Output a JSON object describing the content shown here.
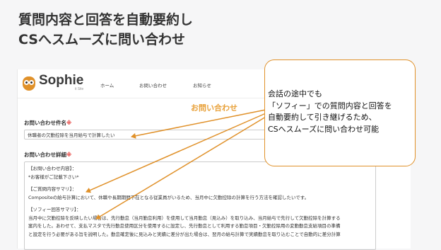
{
  "headline": {
    "line1": "質問内容と回答を自動要約し",
    "line2": "CSへスムーズに問い合わせ"
  },
  "app": {
    "logo": {
      "name": "Sophie",
      "sub": "it Site"
    },
    "nav": [
      "ホーム",
      "お問い合わせ",
      "お知らせ"
    ],
    "page_title": "お問い合わせ",
    "subject": {
      "label": "お問い合わせ件名",
      "required": "※",
      "value": "休職者の欠勤控除を当月給与で計算したい"
    },
    "detail": {
      "label": "お問い合わせ詳細",
      "required": "※",
      "lines": [
        "【お問い合わせ内容】：",
        "*お客様がご記載下さい*",
        "",
        "【ご質問内容サマリ】：",
        "Compositeの給与計算において、休職や長期期間不在となる従業員がいるため、当月中に欠勤控除の計算を行う方法を確認したいです。",
        "",
        "【ソフィー回答サマリ】：",
        "当月中に欠勤控除を反映したい場合は、先行勤怠（当月勤怠利用）を使用して当月勤怠（見込み）を取り込み、当月給与で先行して欠勤控除を計算する",
        "案内をした。あわせて、支払マスタで先行勤怠使用区分を使用するに設定し、先行勤怠として利用する勤怠項目・欠勤控除用の変動勤怠支給項目の準備",
        "と設定を行う必要がある旨を説明した。勤怠確定後に見込みと実績に差分が出た場合は、翌月の給与計算で実績勤怠を取り込むことで自動的に差分計算"
      ]
    }
  },
  "callout": {
    "lines": [
      "会話の途中でも",
      "「ソフィー」での質問内容と回答を",
      "自動要約して引き継げるため、",
      "CSへスムーズに問い合わせ可能"
    ]
  },
  "colors": {
    "accent": "#e0912a",
    "required": "#e53935"
  }
}
